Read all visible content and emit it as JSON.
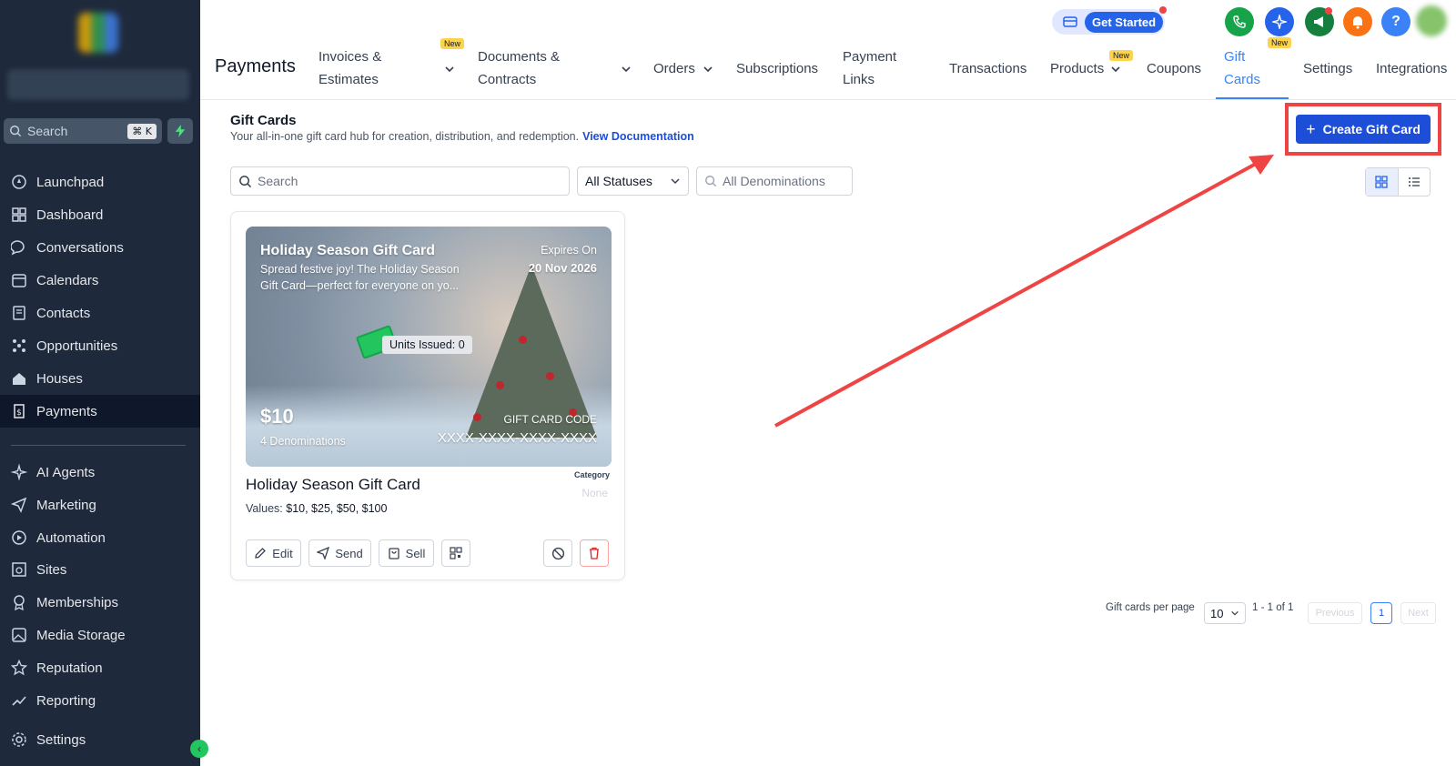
{
  "sidebar": {
    "search_label": "Search",
    "search_shortcut": "⌘ K",
    "items": [
      {
        "label": "Launchpad"
      },
      {
        "label": "Dashboard"
      },
      {
        "label": "Conversations"
      },
      {
        "label": "Calendars"
      },
      {
        "label": "Contacts"
      },
      {
        "label": "Opportunities"
      },
      {
        "label": "Houses"
      },
      {
        "label": "Payments"
      },
      {
        "label": "AI Agents"
      },
      {
        "label": "Marketing"
      },
      {
        "label": "Automation"
      },
      {
        "label": "Sites"
      },
      {
        "label": "Memberships"
      },
      {
        "label": "Media Storage"
      },
      {
        "label": "Reputation"
      },
      {
        "label": "Reporting"
      },
      {
        "label": "Settings"
      }
    ]
  },
  "header": {
    "title": "Payments",
    "get_started": "Get Started",
    "new_badge": "New",
    "help": "?",
    "tabs": [
      {
        "line1": "Invoices &",
        "line2": "Estimates"
      },
      {
        "line1": "Documents &",
        "line2": "Contracts"
      },
      {
        "line1": "Orders"
      },
      {
        "line1": "Subscriptions"
      },
      {
        "line1": "Payment",
        "line2": "Links"
      },
      {
        "line1": "Transactions"
      },
      {
        "line1": "Products"
      },
      {
        "line1": "Coupons"
      },
      {
        "line1": "Gift",
        "line2": "Cards"
      },
      {
        "line1": "Settings"
      },
      {
        "line1": "Integrations"
      }
    ]
  },
  "main": {
    "title": "Gift Cards",
    "subtitle": "Your all-in-one gift card hub for creation, distribution, and redemption.",
    "doc_link": "View Documentation",
    "create_button": "Create Gift Card",
    "filters": {
      "search_placeholder": "Search",
      "status": "All Statuses",
      "denominations_placeholder": "All Denominations"
    }
  },
  "card": {
    "image_title": "Holiday Season Gift Card",
    "image_desc_1": "Spread festive joy! The Holiday Season",
    "image_desc_2": "Gift Card—perfect for everyone on yo...",
    "expires_label": "Expires On",
    "expires_date": "20 Nov 2026",
    "units_issued": "Units Issued: 0",
    "amount": "$10",
    "denominations": "4 Denominations",
    "code_label": "GIFT CARD CODE",
    "code_value": "XXXX-XXXX-XXXX-XXXX",
    "title": "Holiday Season Gift Card",
    "category_label": "Category",
    "category_value": "None",
    "values_label": "Values:",
    "values": "$10, $25, $50, $100",
    "buttons": {
      "edit": "Edit",
      "send": "Send",
      "sell": "Sell"
    }
  },
  "pagination": {
    "per_page_label": "Gift cards per page",
    "per_page": "10",
    "range": "1 - 1 of 1",
    "previous": "Previous",
    "page": "1",
    "next": "Next"
  },
  "colors": {
    "sidebar": "#1e293b",
    "primary": "#1d4ed8",
    "annotation": "#ef4444"
  }
}
